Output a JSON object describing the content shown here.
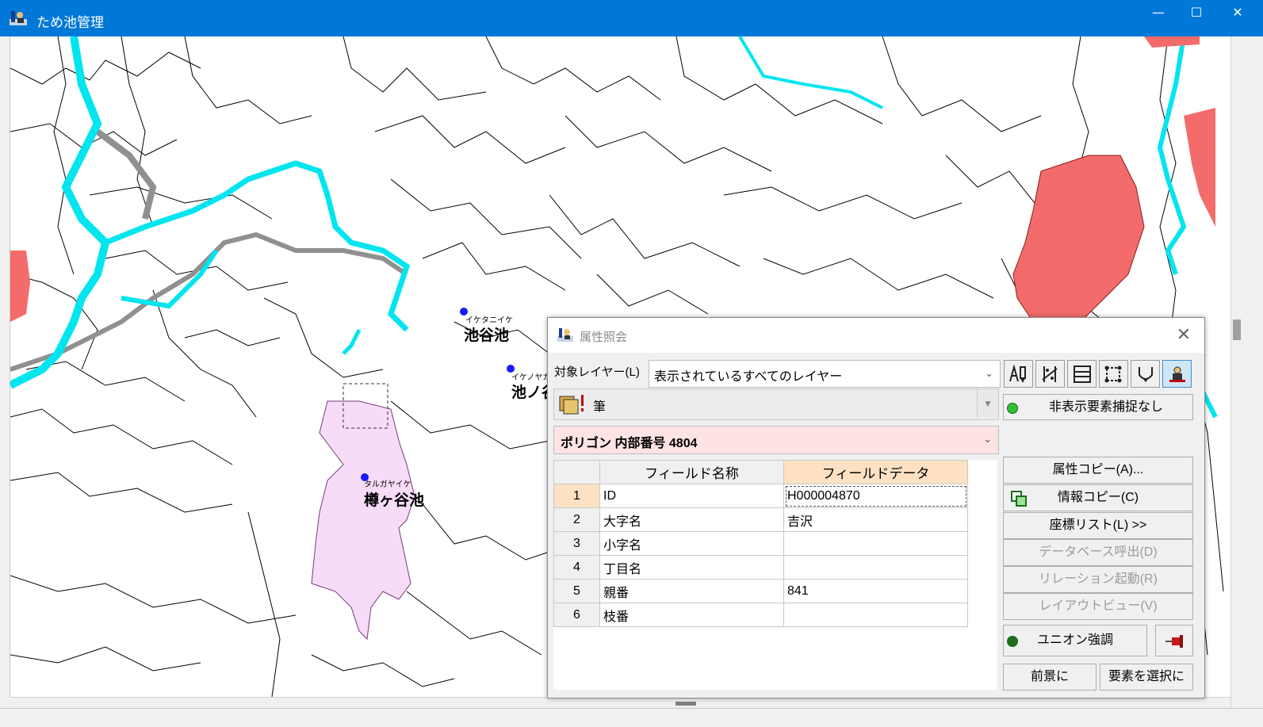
{
  "window": {
    "title": "ため池管理",
    "minimize": "—",
    "maximize": "☐",
    "close": "✕"
  },
  "map": {
    "ponds": [
      {
        "furigana": "イケタニイケ",
        "name": "池谷池"
      },
      {
        "furigana": "イケノヤガ",
        "name": "池ノ谷"
      },
      {
        "furigana": "タルガヤイケ",
        "name": "樽ヶ谷池"
      }
    ],
    "colors": {
      "river": "#00e5ee",
      "selected_polygon": "#f3d7f5",
      "highlight": "#f36b6b",
      "parcel_line": "#000000",
      "point": "#1a1aff"
    }
  },
  "dialog": {
    "title": "属性照会",
    "close": "✕",
    "layer_label": "対象レイヤー(L)",
    "layer_value": "表示されているすべてのレイヤー",
    "field_type": "筆",
    "polygon_info": "ポリゴン 内部番号 4804",
    "toolbar_icons": [
      "attribute-edit-icon",
      "measure-icon",
      "layout-icon",
      "vertex-icon",
      "flow-icon",
      "identify-icon"
    ],
    "hidden_capture": "非表示要素捕捉なし",
    "grid": {
      "headers": [
        "フィールド名称",
        "フィールドデータ"
      ],
      "rows": [
        {
          "num": "1",
          "field": "ID",
          "value": "H000004870"
        },
        {
          "num": "2",
          "field": "大字名",
          "value": "吉沢"
        },
        {
          "num": "3",
          "field": "小字名",
          "value": ""
        },
        {
          "num": "4",
          "field": "丁目名",
          "value": ""
        },
        {
          "num": "5",
          "field": "親番",
          "value": "841"
        },
        {
          "num": "6",
          "field": "枝番",
          "value": ""
        }
      ]
    },
    "buttons": {
      "attr_copy": "属性コピー(A)...",
      "info_copy": "情報コピー(C)",
      "coord_list": "座標リスト(L) >>",
      "db_call": "データベース呼出(D)",
      "relation": "リレーション起動(R)",
      "layout_view": "レイアウトビュー(V)",
      "union": "ユニオン強調",
      "foreground": "前景に",
      "select_element": "要素を選択に"
    }
  }
}
